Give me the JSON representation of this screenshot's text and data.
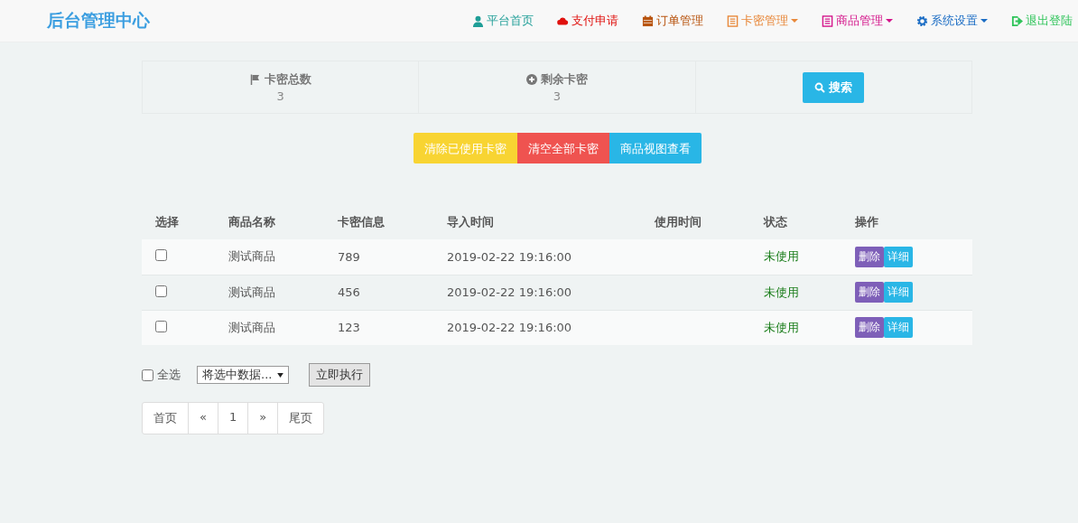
{
  "brand": "后台管理中心",
  "nav": [
    {
      "label": "平台首页",
      "kind": "user",
      "color": "#1f9e97",
      "dropdown": false
    },
    {
      "label": "支付申请",
      "kind": "cloud",
      "color": "#e0110e",
      "dropdown": false
    },
    {
      "label": "订单管理",
      "kind": "calendar",
      "color": "#b8540f",
      "dropdown": false
    },
    {
      "label": "卡密管理",
      "kind": "list",
      "color": "#e8883a",
      "dropdown": true
    },
    {
      "label": "商品管理",
      "kind": "list",
      "color": "#d4148a",
      "dropdown": true
    },
    {
      "label": "系统设置",
      "kind": "gear",
      "color": "#1a6cc4",
      "dropdown": true
    },
    {
      "label": "退出登陆",
      "kind": "exit",
      "color": "#2fc45a",
      "dropdown": false
    }
  ],
  "stats": [
    {
      "label": "卡密总数",
      "kind": "flag",
      "value": "3"
    },
    {
      "label": "剩余卡密",
      "kind": "plus",
      "value": "3"
    }
  ],
  "search_button": "搜索",
  "actions": [
    {
      "label": "清除已使用卡密",
      "color": "#f8d432"
    },
    {
      "label": "清空全部卡密",
      "color": "#ef5350"
    },
    {
      "label": "商品视图查看",
      "color": "#29b6e6"
    }
  ],
  "table": {
    "columns": [
      "选择",
      "商品名称",
      "卡密信息",
      "导入时间",
      "使用时间",
      "状态",
      "操作"
    ],
    "rows": [
      {
        "checked": false,
        "name": "测试商品",
        "card": "789",
        "imported": "2019-02-22 19:16:00",
        "status": "未使用",
        "delete": "删除",
        "detail": "详细"
      },
      {
        "checked": false,
        "name": "测试商品",
        "card": "456",
        "imported": "2019-02-22 19:16:00",
        "status": "未使用",
        "delete": "删除",
        "detail": "详细"
      },
      {
        "checked": false,
        "name": "测试商品",
        "card": "123",
        "imported": "2019-02-22 19:16:00",
        "status": "未使用",
        "delete": "删除",
        "detail": "详细"
      }
    ]
  },
  "select_all": {
    "label": "全选",
    "checked": false
  },
  "bulk_select": "将选中数据...",
  "execute_button": "立即执行",
  "pagination": [
    "首页",
    "«",
    "1",
    "»",
    "尾页"
  ]
}
